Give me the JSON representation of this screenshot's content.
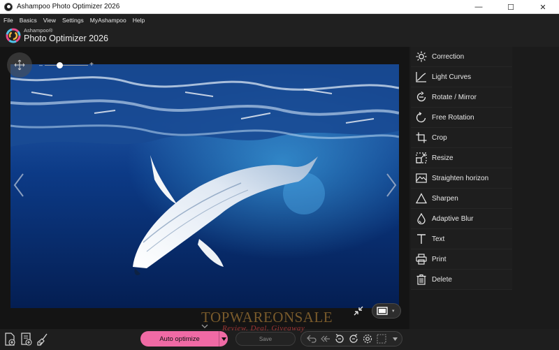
{
  "window": {
    "title": "Ashampoo Photo Optimizer 2026",
    "controls": {
      "minimize": "—",
      "maximize": "☐",
      "close": "✕"
    }
  },
  "menu": {
    "items": [
      "File",
      "Basics",
      "View",
      "Settings",
      "MyAshampoo",
      "Help"
    ]
  },
  "brand": {
    "vendor": "Ashampoo®",
    "product": "Photo Optimizer 2026"
  },
  "viewer": {
    "zoom": {
      "minus": "–",
      "plus": "+",
      "level_fraction": 0.35
    },
    "prev_icon": "chevron-left-icon",
    "next_icon": "chevron-right-icon"
  },
  "sidebar": {
    "items": [
      {
        "label": "Correction",
        "icon": "sun-icon"
      },
      {
        "label": "Light Curves",
        "icon": "curve-icon"
      },
      {
        "label": "Rotate / Mirror",
        "icon": "rotate-icon"
      },
      {
        "label": "Free Rotation",
        "icon": "free-rotation-icon"
      },
      {
        "label": "Crop",
        "icon": "crop-icon"
      },
      {
        "label": "Resize",
        "icon": "resize-icon"
      },
      {
        "label": "Straighten horizon",
        "icon": "horizon-icon"
      },
      {
        "label": "Sharpen",
        "icon": "triangle-icon"
      },
      {
        "label": "Adaptive Blur",
        "icon": "drop-icon"
      },
      {
        "label": "Text",
        "icon": "text-icon"
      },
      {
        "label": "Print",
        "icon": "printer-icon"
      },
      {
        "label": "Delete",
        "icon": "trash-icon"
      }
    ]
  },
  "bottom": {
    "auto_optimize": "Auto optimize",
    "save": "Save"
  },
  "watermark": {
    "line1": "TOPWAREONSALE",
    "line2": "Review. Deal. Giveaway"
  },
  "colors": {
    "accent_pink": "#f06aa5",
    "panel_bg": "#1e1e1e",
    "ocean_deep": "#062a66"
  }
}
